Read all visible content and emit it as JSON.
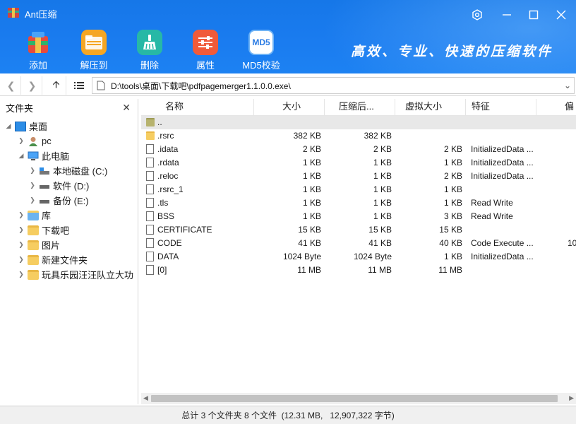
{
  "app": {
    "title": "Ant压缩"
  },
  "toolbar": {
    "add_label": "添加",
    "extract_label": "解压到",
    "delete_label": "删除",
    "properties_label": "属性",
    "md5_label": "MD5校验",
    "md5_icon_text": "MD5",
    "slogan": "高效、专业、快速的压缩软件"
  },
  "address": {
    "path": "D:\\tools\\桌面\\下载吧\\pdfpagemerger1.1.0.0.exe\\"
  },
  "tree": {
    "title": "文件夹",
    "items": [
      {
        "label": "桌面"
      },
      {
        "label": "pc"
      },
      {
        "label": "此电脑"
      },
      {
        "label": "本地磁盘 (C:)"
      },
      {
        "label": "软件 (D:)"
      },
      {
        "label": "备份 (E:)"
      },
      {
        "label": "库"
      },
      {
        "label": "下载吧"
      },
      {
        "label": "图片"
      },
      {
        "label": "新建文件夹"
      },
      {
        "label": "玩具乐园汪汪队立大功"
      }
    ]
  },
  "columns": {
    "name": "名称",
    "size": "大小",
    "packed": "压缩后...",
    "vsize": "虚拟大小",
    "char": "特征",
    "offset": "偏"
  },
  "files": [
    {
      "name": "..",
      "size": "",
      "packed": "",
      "vsize": "",
      "char": "",
      "extra": ""
    },
    {
      "name": ".rsrc",
      "size": "382 KB",
      "packed": "382 KB",
      "vsize": "",
      "char": "",
      "extra": ""
    },
    {
      "name": ".idata",
      "size": "2 KB",
      "packed": "2 KB",
      "vsize": "2 KB",
      "char": "InitializedData ...",
      "extra": ""
    },
    {
      "name": ".rdata",
      "size": "1 KB",
      "packed": "1 KB",
      "vsize": "1 KB",
      "char": "InitializedData ...",
      "extra": ""
    },
    {
      "name": ".reloc",
      "size": "1 KB",
      "packed": "1 KB",
      "vsize": "2 KB",
      "char": "InitializedData ...",
      "extra": ""
    },
    {
      "name": ".rsrc_1",
      "size": "1 KB",
      "packed": "1 KB",
      "vsize": "1 KB",
      "char": "",
      "extra": ""
    },
    {
      "name": ".tls",
      "size": "1 KB",
      "packed": "1 KB",
      "vsize": "1 KB",
      "char": "Read Write",
      "extra": ""
    },
    {
      "name": "BSS",
      "size": "1 KB",
      "packed": "1 KB",
      "vsize": "3 KB",
      "char": "Read Write",
      "extra": ""
    },
    {
      "name": "CERTIFICATE",
      "size": "15 KB",
      "packed": "15 KB",
      "vsize": "15 KB",
      "char": "",
      "extra": ""
    },
    {
      "name": "CODE",
      "size": "41 KB",
      "packed": "41 KB",
      "vsize": "40 KB",
      "char": "Code Execute ...",
      "extra": "10"
    },
    {
      "name": "DATA",
      "size": "1024 Byte",
      "packed": "1024 Byte",
      "vsize": "1 KB",
      "char": "InitializedData ...",
      "extra": ""
    },
    {
      "name": "[0]",
      "size": "11 MB",
      "packed": "11 MB",
      "vsize": "11 MB",
      "char": "",
      "extra": ""
    }
  ],
  "status": {
    "text": "总计 3 个文件夹 8 个文件  (12.31 MB,   12,907,322 字节)"
  }
}
